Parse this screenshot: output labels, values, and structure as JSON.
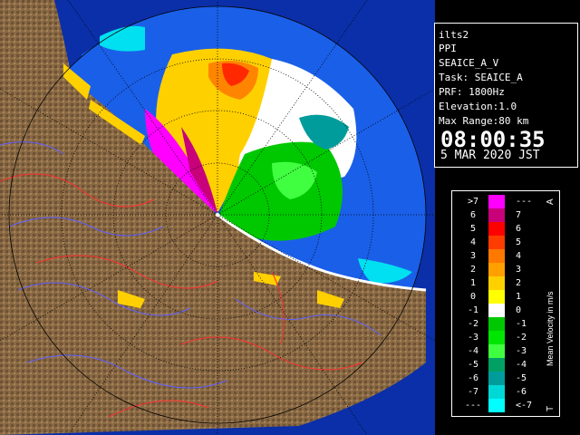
{
  "info": {
    "radar_name": "ilts2",
    "product": "PPI",
    "task_line": "SEAICE_A_V",
    "task": "Task: SEAICE_A",
    "prf": "PRF: 1800Hz",
    "elevation": "Elevation:1.0",
    "max_range": "Max Range:80 km",
    "time": "08:00:35",
    "date": "5 MAR 2020 JST"
  },
  "legend": {
    "title": "Mean Velocity in m/s",
    "top_marker": "A",
    "bottom_marker": "T",
    "rows": [
      {
        "left": ">7",
        "right": "---",
        "color": "#ff00ff"
      },
      {
        "left": "6",
        "right": "7",
        "color": "#c8007a"
      },
      {
        "left": "5",
        "right": "6",
        "color": "#ff0000"
      },
      {
        "left": "4",
        "right": "5",
        "color": "#ff3c00"
      },
      {
        "left": "3",
        "right": "4",
        "color": "#ff7800"
      },
      {
        "left": "2",
        "right": "3",
        "color": "#ffa000"
      },
      {
        "left": "1",
        "right": "2",
        "color": "#ffd000"
      },
      {
        "left": "0",
        "right": "1",
        "color": "#ffff00"
      },
      {
        "left": "-1",
        "right": "0",
        "color": "#ffffff"
      },
      {
        "left": "-2",
        "right": "-1",
        "color": "#00c800"
      },
      {
        "left": "-3",
        "right": "-2",
        "color": "#00e600"
      },
      {
        "left": "-4",
        "right": "-3",
        "color": "#40ff40"
      },
      {
        "left": "-5",
        "right": "-4",
        "color": "#00a064"
      },
      {
        "left": "-6",
        "right": "-5",
        "color": "#009c9c"
      },
      {
        "left": "-7",
        "right": "-6",
        "color": "#00d8d8"
      },
      {
        "left": "---",
        "right": "<-7",
        "color": "#00ffff"
      }
    ]
  },
  "colors": {
    "sea_blue": "#1a5fe8",
    "range_blue": "#1e78f0",
    "land": "#8a6a44",
    "land_dark": "#4e3a24",
    "river": "#6060ff",
    "border": "#ff3030"
  }
}
